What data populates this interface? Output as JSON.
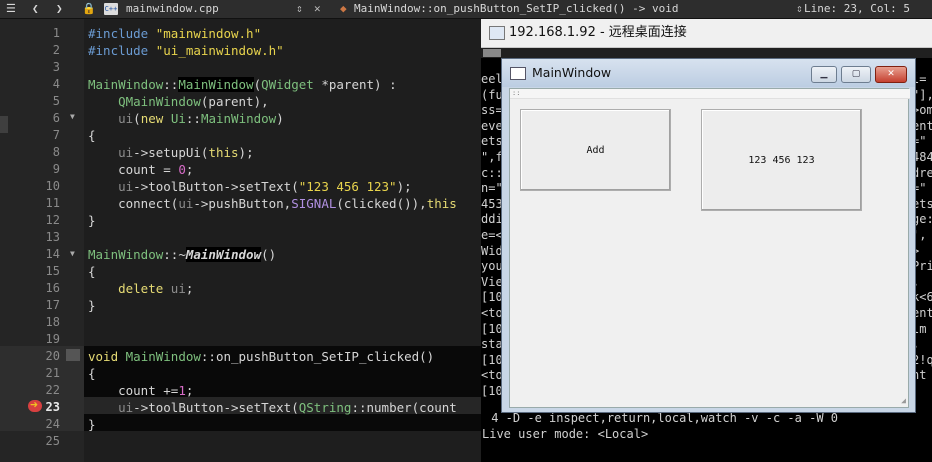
{
  "editor": {
    "file_tab": "mainwindow.cpp",
    "function_path": "MainWindow::on_pushButton_SetIP_clicked() -> void",
    "cursor_pos": "Line: 23, Col: 5",
    "line_numbers": [
      "1",
      "2",
      "3",
      "4",
      "5",
      "6",
      "7",
      "8",
      "9",
      "10",
      "11",
      "12",
      "13",
      "14",
      "15",
      "16",
      "17",
      "18",
      "19",
      "20",
      "21",
      "22",
      "23",
      "24",
      "25"
    ]
  },
  "remote": {
    "title": "192.168.1.92 - 远程桌面连接",
    "console_right": [
      "l=",
      "\"],",
      ">om:",
      "ent",
      "=\"",
      "484",
      "dre",
      "=\"",
      "ets",
      "ge:",
      "',",
      ">",
      "Pri",
      ",",
      "k<6",
      "ent",
      "lm",
      ",",
      "2!q",
      "nt"
    ],
    "console_left": [
      "eel",
      "(fu",
      "ss=",
      "eve",
      "ets",
      "\",f",
      "c::",
      "n=\"",
      "453",
      "ddi",
      "e=<",
      "Wid",
      "you",
      "Vie",
      "[10",
      "<to",
      "[10",
      "sta",
      "[10",
      "<to",
      "[10"
    ],
    "console_bottom1": " 4 -D -e inspect,return,local,watch -v -c -a -W 0",
    "console_bottom2": "Live user mode: <Local>"
  },
  "qt_window": {
    "title": "MainWindow",
    "add_button": "Add",
    "tool_button": "123 456 123",
    "menu_text": "::"
  },
  "colors": {
    "editor_bg": "#1e1e1e",
    "gutter_bg": "#252525",
    "string": "#e8d44d",
    "class": "#7ec07e",
    "preprocessor": "#6b9bd2",
    "breakpoint": "#e04040"
  }
}
